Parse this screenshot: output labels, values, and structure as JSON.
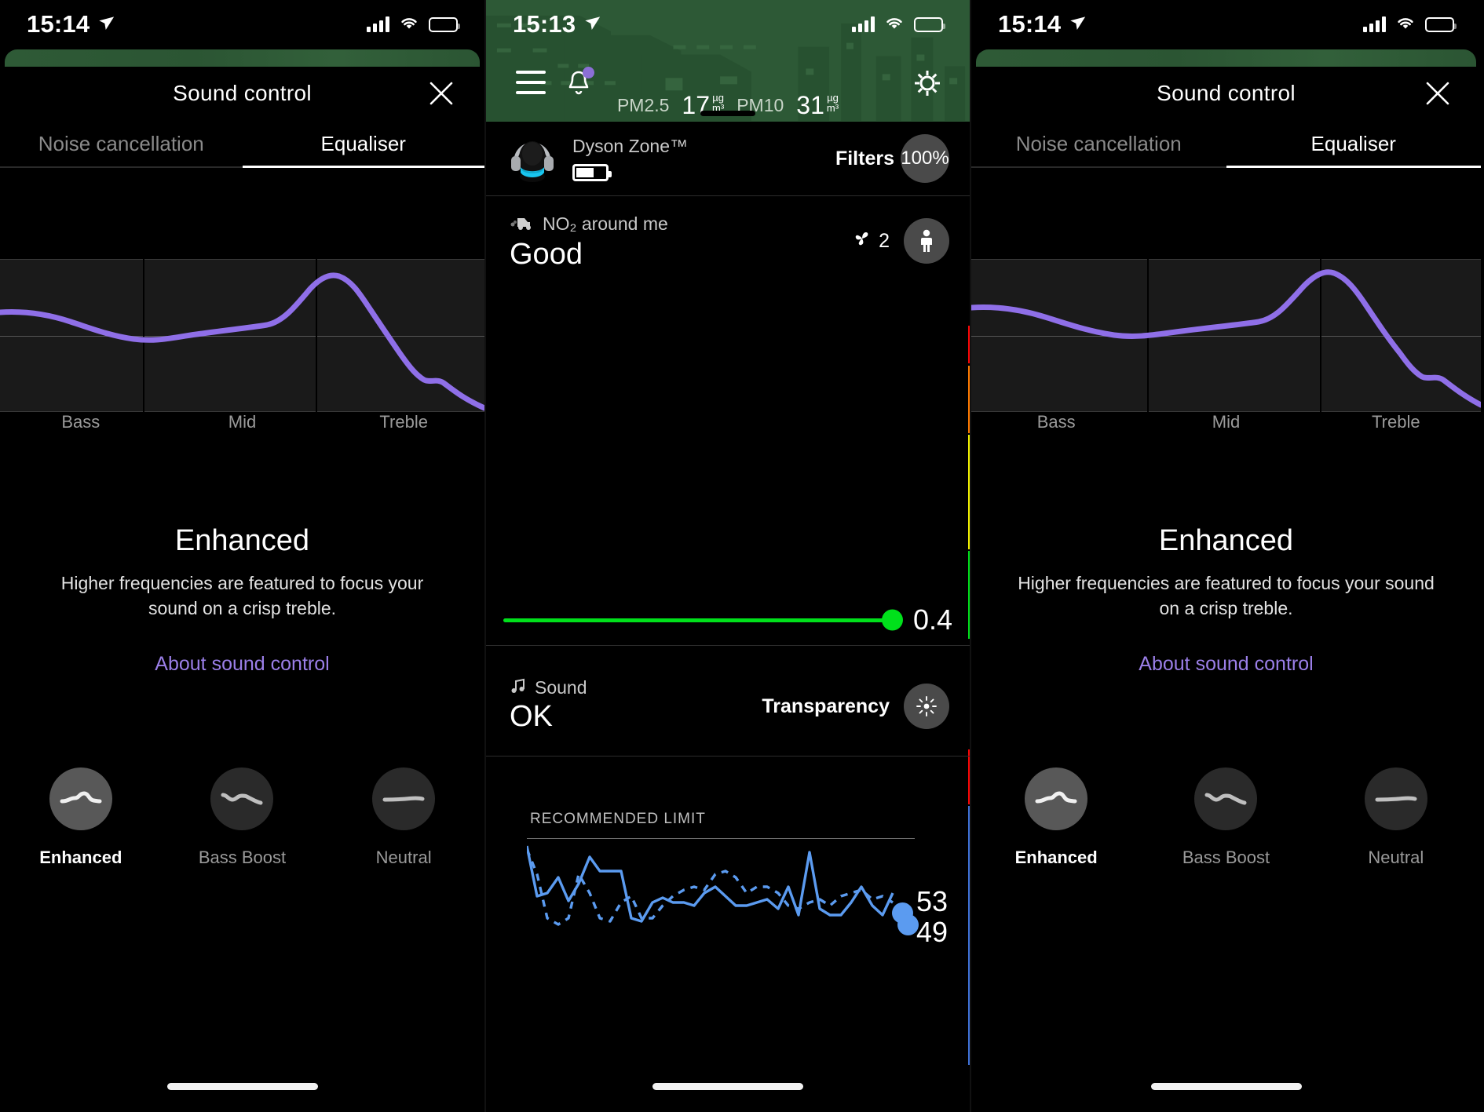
{
  "panels": {
    "left": {
      "status": {
        "time": "15:14",
        "location_icon": "location-arrow-icon",
        "signal_icon": "cellular-bars-icon",
        "wifi_icon": "wifi-icon",
        "battery_icon": "battery-icon"
      },
      "sheet_title": "Sound control",
      "close_icon": "close-icon",
      "tabs": [
        {
          "label": "Noise cancellation",
          "active": false
        },
        {
          "label": "Equaliser",
          "active": true
        }
      ],
      "eq_labels": [
        "Bass",
        "Mid",
        "Treble"
      ],
      "preset_name": "Enhanced",
      "preset_desc": "Higher frequencies are featured to focus your sound on a crisp treble.",
      "about_link": "About sound control",
      "presets": [
        {
          "label": "Enhanced",
          "selected": true,
          "icon": "eq-curve-enhanced-icon"
        },
        {
          "label": "Bass Boost",
          "selected": false,
          "icon": "eq-curve-bassboost-icon"
        },
        {
          "label": "Neutral",
          "selected": false,
          "icon": "eq-curve-neutral-icon"
        }
      ]
    },
    "mid": {
      "status": {
        "time": "15:13",
        "location_icon": "location-arrow-icon",
        "signal_icon": "cellular-bars-icon",
        "wifi_icon": "wifi-icon",
        "battery_icon": "battery-icon"
      },
      "menu_icon": "hamburger-menu-icon",
      "bell_icon": "notification-bell-icon",
      "gear_icon": "settings-gear-icon",
      "air_quality": [
        {
          "label": "PM2.5",
          "value": "17",
          "unit_num": "µg",
          "unit_den": "m³"
        },
        {
          "label": "PM10",
          "value": "31",
          "unit_num": "µg",
          "unit_den": "m³"
        }
      ],
      "device": {
        "icon": "dyson-zone-headphones-icon",
        "name": "Dyson Zone™",
        "battery_icon": "battery-icon",
        "filters_label": "Filters",
        "filters_value": "100%"
      },
      "no2": {
        "icon": "traffic-pollution-icon",
        "label": "NO₂ around me",
        "value": "Good",
        "fan_icon": "fan-icon",
        "fan_value": "2",
        "mode_icon": "person-icon"
      },
      "slider": {
        "value": "0.4",
        "color": "#00e01b"
      },
      "sound": {
        "icon": "music-note-icon",
        "label": "Sound",
        "value": "OK",
        "mode_label": "Transparency",
        "mode_icon": "transparency-sun-icon"
      },
      "sound_chart_label": "RECOMMENDED LIMIT",
      "sound_readings": [
        "53",
        "49"
      ]
    },
    "right": {
      "status": {
        "time": "15:14",
        "location_icon": "location-arrow-icon",
        "signal_icon": "cellular-bars-icon",
        "wifi_icon": "wifi-icon",
        "battery_icon": "battery-icon"
      },
      "sheet_title": "Sound control",
      "close_icon": "close-icon",
      "tabs": [
        {
          "label": "Noise cancellation",
          "active": false
        },
        {
          "label": "Equaliser",
          "active": true
        }
      ],
      "eq_labels": [
        "Bass",
        "Mid",
        "Treble"
      ],
      "preset_name": "Enhanced",
      "preset_desc": "Higher frequencies are featured to focus your sound on a crisp treble.",
      "about_link": "About sound control",
      "presets": [
        {
          "label": "Enhanced",
          "selected": true,
          "icon": "eq-curve-enhanced-icon"
        },
        {
          "label": "Bass Boost",
          "selected": false,
          "icon": "eq-curve-bassboost-icon"
        },
        {
          "label": "Neutral",
          "selected": false,
          "icon": "eq-curve-neutral-icon"
        }
      ]
    }
  },
  "chart_data": [
    {
      "type": "line",
      "name": "equaliser-curve-enhanced",
      "title": "Equaliser – Enhanced",
      "xlabel": "",
      "ylabel": "",
      "categories": [
        "Bass",
        "Mid",
        "Treble"
      ],
      "grid": true,
      "legend": "none",
      "x": [
        0,
        5,
        12,
        20,
        28,
        33,
        40,
        48,
        56,
        62,
        66,
        70,
        74,
        80,
        86,
        92,
        96,
        100
      ],
      "y": [
        62,
        62,
        61,
        57,
        52,
        50,
        50,
        52,
        54,
        57,
        66,
        80,
        86,
        82,
        74,
        60,
        40,
        30
      ],
      "series_color": "#8f6fe8"
    },
    {
      "type": "line",
      "name": "sound-level-history",
      "title": "Sound level history",
      "annotations": [
        "RECOMMENDED LIMIT"
      ],
      "current_values": {
        "solid": 53,
        "dashed": 49
      },
      "series": [
        {
          "name": "solid",
          "style": "solid",
          "values": [
            95,
            60,
            62,
            72,
            58,
            70,
            88,
            78,
            78,
            78,
            42,
            40,
            52,
            55,
            52,
            52,
            50,
            58,
            62,
            56,
            50,
            50,
            52,
            54,
            48,
            60,
            44,
            88,
            48,
            44,
            44,
            52,
            60,
            50,
            44,
            53
          ]
        },
        {
          "name": "dashed",
          "style": "dashed",
          "values": [
            93,
            72,
            44,
            40,
            44,
            72,
            60,
            44,
            42,
            55,
            58,
            44,
            44,
            52,
            58,
            62,
            64,
            62,
            70,
            72,
            68,
            58,
            62,
            62,
            58,
            50,
            48,
            52,
            54,
            50,
            56,
            58,
            60,
            54,
            56,
            49
          ]
        }
      ],
      "series_color": "#5b9bf0",
      "ylim": [
        0,
        100
      ]
    }
  ],
  "colors": {
    "accent_purple": "#8f6fe8",
    "link_purple": "#9b7fe8",
    "green_good": "#00e01b",
    "blue_sound": "#5b9bf0",
    "hero_green": "#2d5936",
    "scale_red": "#fb0606",
    "scale_orange": "#ff7a00",
    "scale_yellow": "#f5f500",
    "scale_green": "#00e01b"
  }
}
